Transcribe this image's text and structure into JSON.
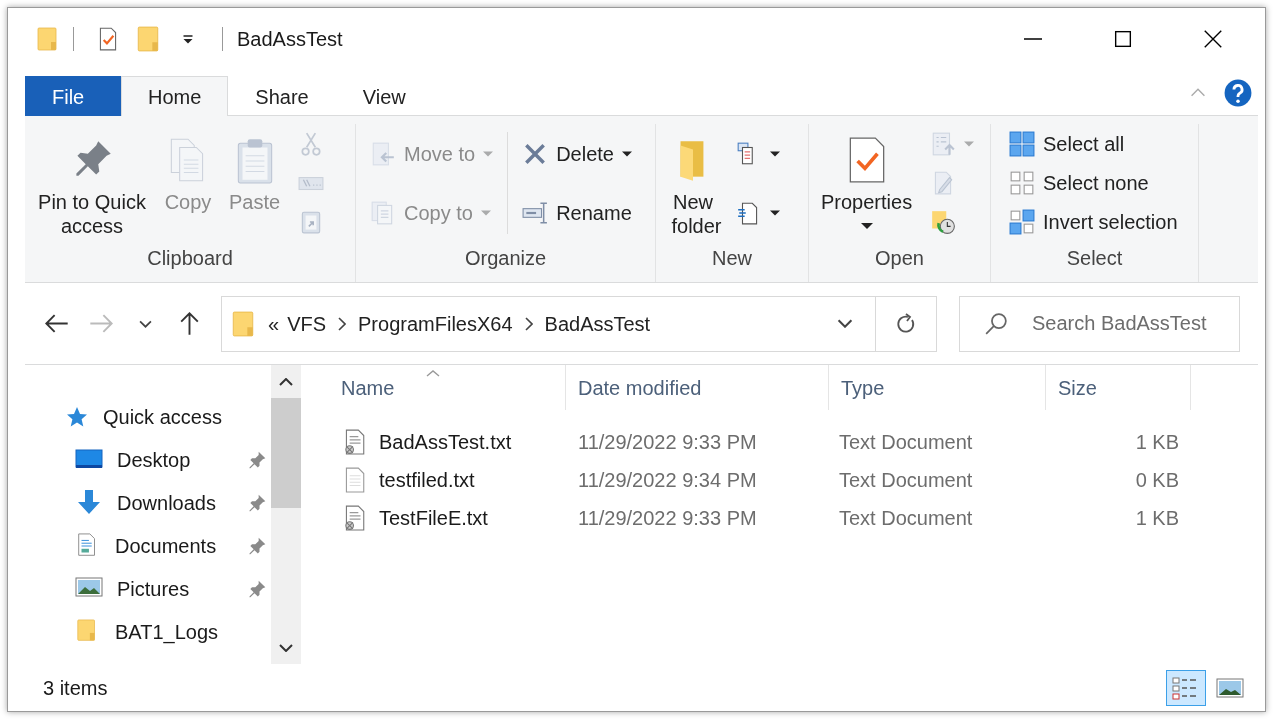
{
  "window": {
    "title": "BadAssTest"
  },
  "tabs": [
    {
      "label": "File",
      "kind": "menu",
      "selected": false
    },
    {
      "label": "Home",
      "kind": "tab",
      "selected": true
    },
    {
      "label": "Share",
      "kind": "tab",
      "selected": false
    },
    {
      "label": "View",
      "kind": "tab",
      "selected": false
    }
  ],
  "ribbon": {
    "groups": [
      {
        "label": "Clipboard",
        "buttons": [
          {
            "kind": "large",
            "label": "Pin to Quick access",
            "disabled": false
          },
          {
            "kind": "large",
            "label": "Copy",
            "disabled": true
          },
          {
            "kind": "large",
            "label": "Paste",
            "disabled": true
          },
          {
            "kind": "icon",
            "disabled": true
          },
          {
            "kind": "icon",
            "disabled": true
          },
          {
            "kind": "icon",
            "disabled": true
          }
        ]
      },
      {
        "label": "Organize",
        "buttons": [
          {
            "kind": "small",
            "label": "Move to",
            "disabled": true,
            "dropdown": true
          },
          {
            "kind": "small",
            "label": "Copy to",
            "disabled": true,
            "dropdown": true
          },
          {
            "kind": "small",
            "label": "Delete",
            "disabled": false,
            "dropdown": true
          },
          {
            "kind": "small",
            "label": "Rename",
            "disabled": false
          }
        ]
      },
      {
        "label": "New",
        "buttons": [
          {
            "kind": "large",
            "label": "New folder",
            "disabled": false
          },
          {
            "kind": "icon",
            "disabled": false,
            "dropdown": true
          },
          {
            "kind": "icon",
            "disabled": false,
            "dropdown": true
          }
        ]
      },
      {
        "label": "Open",
        "buttons": [
          {
            "kind": "large",
            "label": "Properties",
            "disabled": false,
            "dropdown": true
          },
          {
            "kind": "icon",
            "disabled": true,
            "dropdown": true
          },
          {
            "kind": "icon",
            "disabled": true
          },
          {
            "kind": "icon",
            "disabled": false
          }
        ]
      },
      {
        "label": "Select",
        "buttons": [
          {
            "kind": "small",
            "label": "Select all",
            "disabled": false
          },
          {
            "kind": "small",
            "label": "Select none",
            "disabled": false
          },
          {
            "kind": "small",
            "label": "Invert selection",
            "disabled": false
          }
        ]
      }
    ]
  },
  "address_bar": {
    "overflow": "«",
    "path": [
      "VFS",
      "ProgramFilesX64",
      "BadAssTest"
    ]
  },
  "search": {
    "placeholder": "Search BadAssTest"
  },
  "navigation_pane": {
    "items": [
      {
        "label": "Quick access",
        "kind": "header",
        "pinned": false
      },
      {
        "label": "Desktop",
        "kind": "item",
        "pinned": true
      },
      {
        "label": "Downloads",
        "kind": "item",
        "pinned": true
      },
      {
        "label": "Documents",
        "kind": "item",
        "pinned": true
      },
      {
        "label": "Pictures",
        "kind": "item",
        "pinned": true
      },
      {
        "label": "BAT1_Logs",
        "kind": "item",
        "pinned": false
      }
    ]
  },
  "file_list": {
    "columns": [
      {
        "label": "Name",
        "sorted": true
      },
      {
        "label": "Date modified",
        "sorted": false
      },
      {
        "label": "Type",
        "sorted": false
      },
      {
        "label": "Size",
        "sorted": false
      }
    ],
    "rows": [
      {
        "name": "BadAssTest.txt",
        "date_modified": "11/29/2022 9:33 PM",
        "type": "Text Document",
        "size": "1 KB"
      },
      {
        "name": "testfiled.txt",
        "date_modified": "11/29/2022 9:34 PM",
        "type": "Text Document",
        "size": "0 KB"
      },
      {
        "name": "TestFileE.txt",
        "date_modified": "11/29/2022 9:33 PM",
        "type": "Text Document",
        "size": "1 KB"
      }
    ]
  },
  "status_bar": {
    "item_count": "3 items",
    "view_buttons": [
      {
        "selected": true
      },
      {
        "selected": false
      }
    ]
  }
}
